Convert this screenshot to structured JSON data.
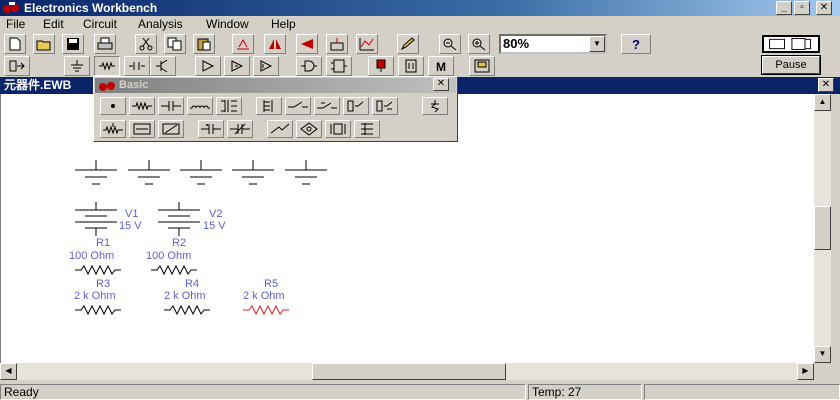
{
  "window": {
    "title": "Electronics Workbench"
  },
  "menu": [
    "File",
    "Edit",
    "Circuit",
    "Analysis",
    "Window",
    "Help"
  ],
  "toolbar": {
    "zoom_value": "80%",
    "help_label": "?",
    "pause_label": "Pause"
  },
  "document": {
    "title": "元器件.EWB"
  },
  "palette": {
    "title": "Basic"
  },
  "circuit": {
    "v1": {
      "name": "V1",
      "value": "15 V"
    },
    "v2": {
      "name": "V2",
      "value": "15 V"
    },
    "r1": {
      "name": "R1",
      "value": "100  Ohm"
    },
    "r2": {
      "name": "R2",
      "value": "100  Ohm"
    },
    "r3": {
      "name": "R3",
      "value": "2 k Ohm"
    },
    "r4": {
      "name": "R4",
      "value": "2 k Ohm"
    },
    "r5": {
      "name": "R5",
      "value": "2 k Ohm"
    }
  },
  "status": {
    "ready": "Ready",
    "temp": "Temp:  27"
  },
  "colors": {
    "title_bar": "#0a246a",
    "component_label": "#6060d8",
    "selected_component": "#e02020"
  }
}
